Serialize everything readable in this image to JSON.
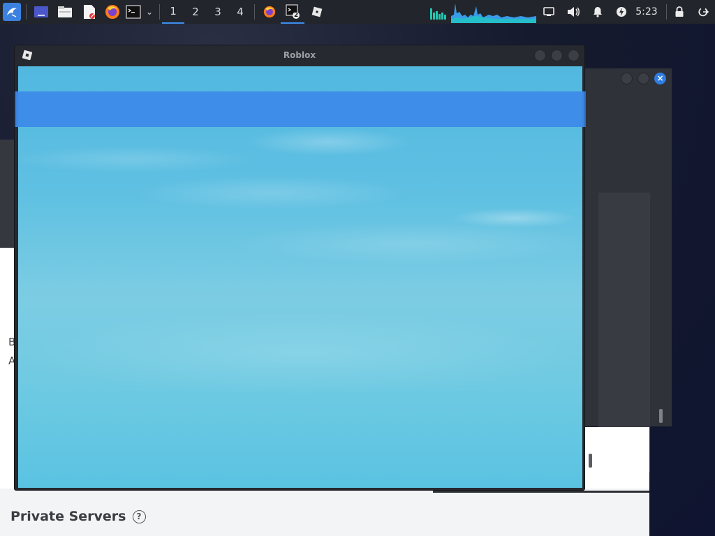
{
  "taskbar": {
    "workspaces": [
      "1",
      "2",
      "3",
      "4"
    ],
    "active_workspace": "1",
    "terminal_badge": "2",
    "clock": "5:23",
    "accent_color": "#3d8ef0",
    "icons": [
      "kali-menu-icon",
      "show-desktop-icon",
      "file-manager-icon",
      "text-editor-icon",
      "firefox-icon",
      "terminal-icon",
      "chevron-down-icon",
      "firefox-task-icon",
      "terminal-task-icon",
      "roblox-task-icon",
      "cpu-graph-icon",
      "network-graph-icon",
      "network-icon",
      "volume-icon",
      "notification-bell-icon",
      "power-manager-icon",
      "lock-icon",
      "logout-icon"
    ]
  },
  "roblox_window": {
    "title": "Roblox",
    "bar_color": "#3d8ae8",
    "sky_color": "#5fc0e2"
  },
  "browser": {
    "section_title": "Private Servers",
    "help_icon_glyph": "?",
    "left_letters": [
      "B",
      "A"
    ]
  }
}
